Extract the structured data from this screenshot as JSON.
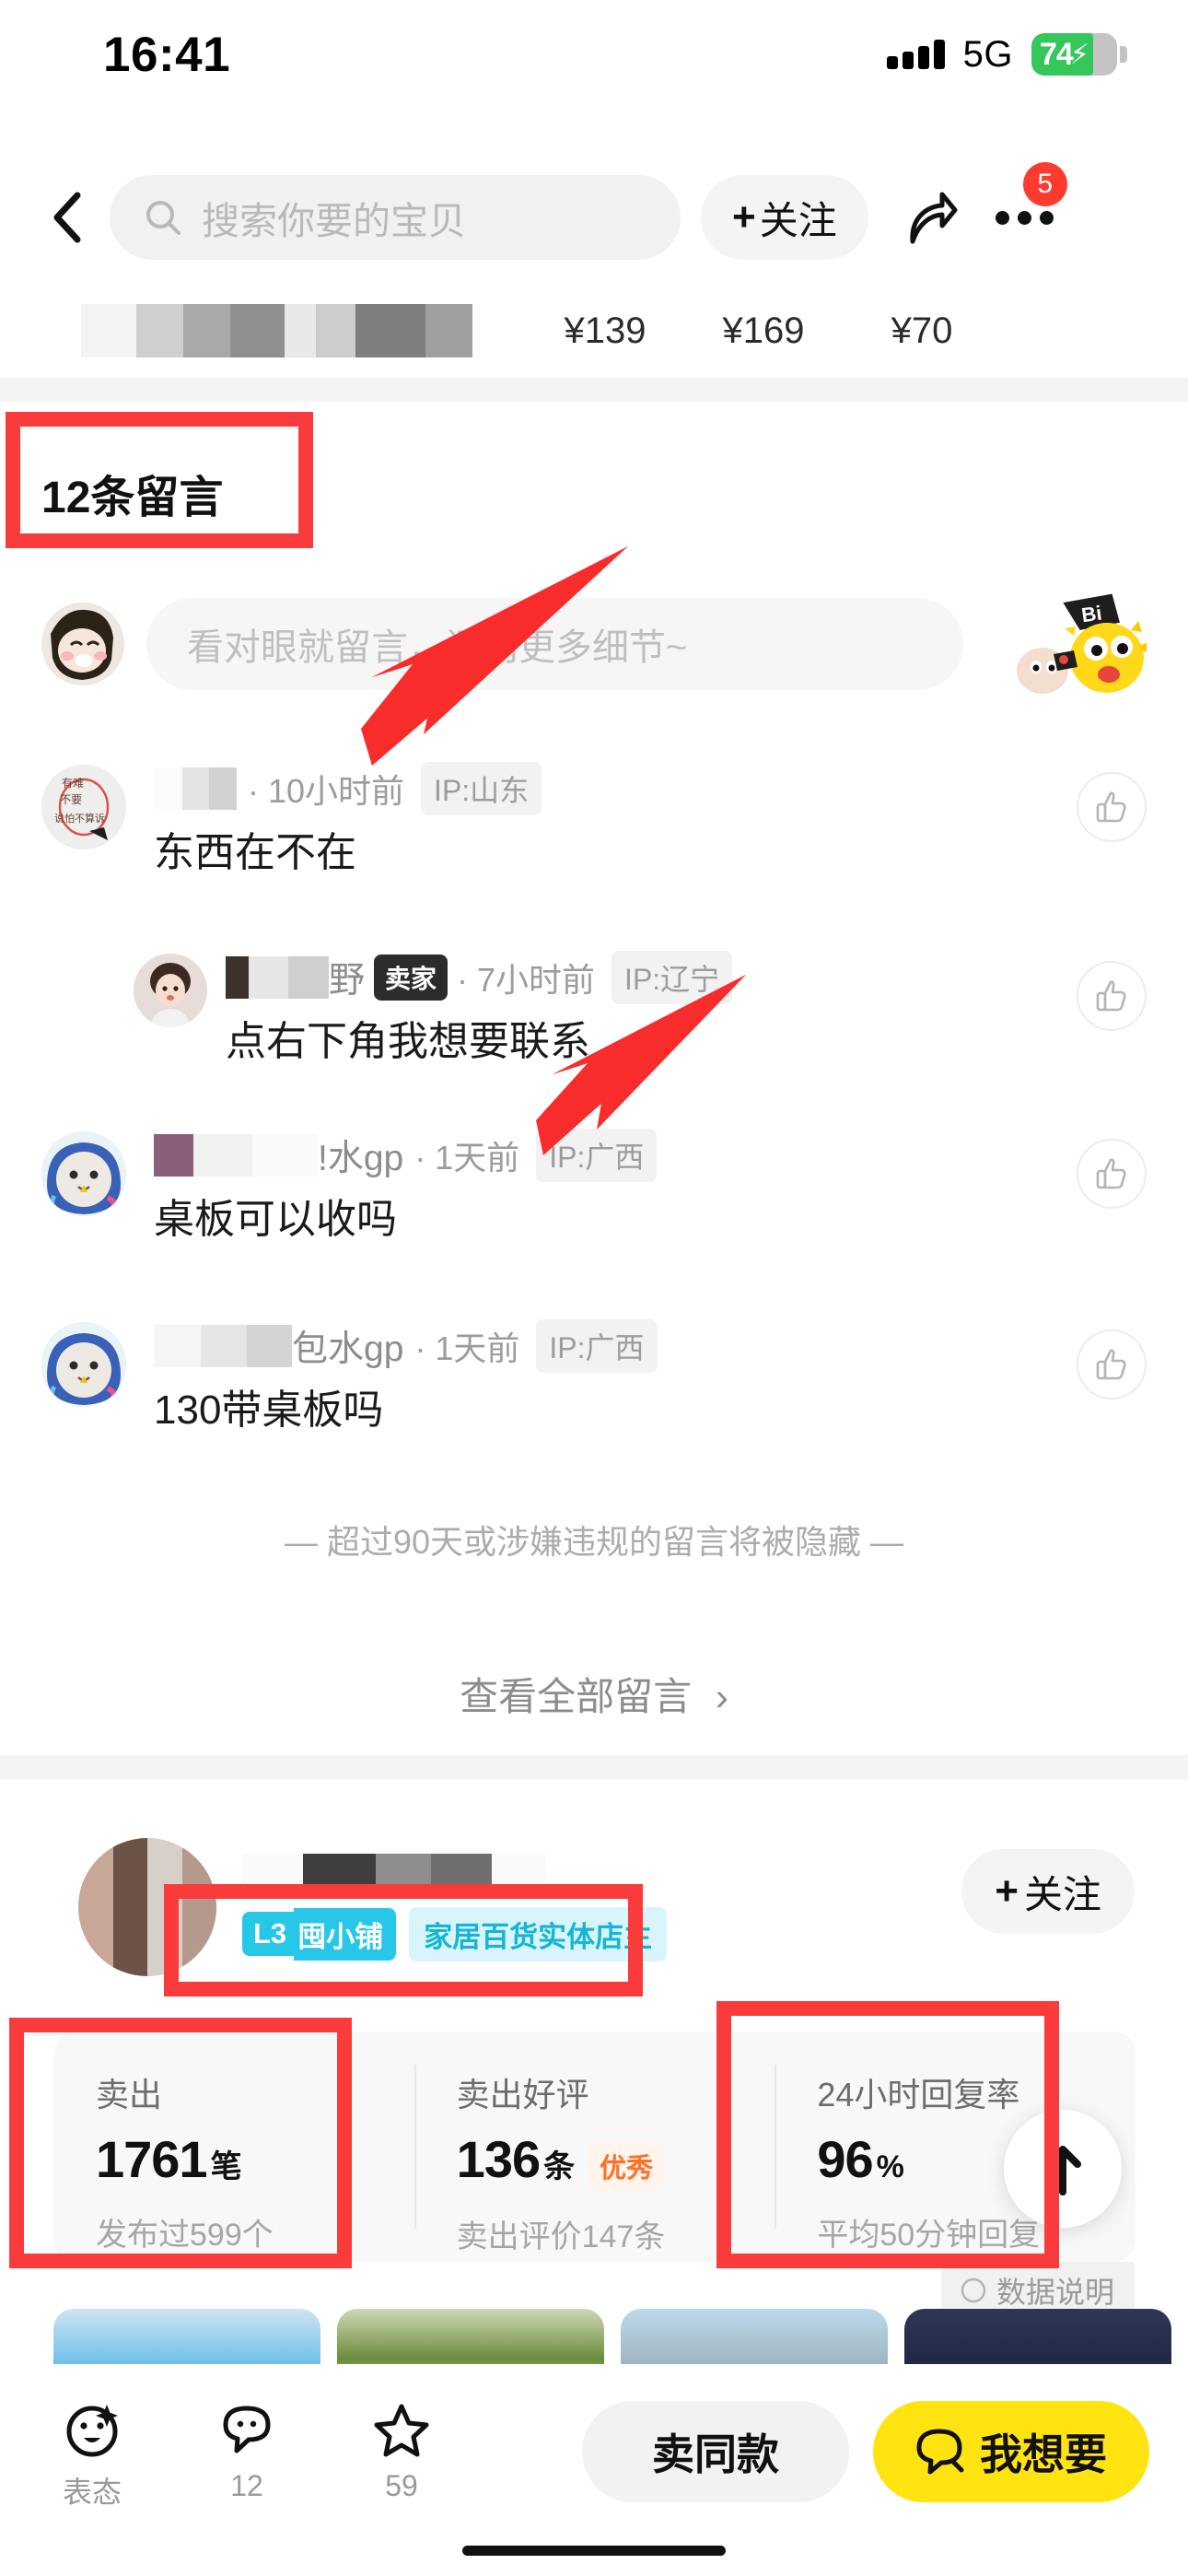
{
  "status_bar": {
    "time": "16:41",
    "network": "5G",
    "battery_percent": "74",
    "charging": true
  },
  "nav": {
    "back_icon": "chevron-left-icon",
    "search_placeholder": "搜索你要的宝贝",
    "follow_label": "关注",
    "share_icon": "share-arrow-icon",
    "more_icon": "more-dots-icon",
    "more_badge": "5"
  },
  "price_row": {
    "prices": [
      "¥139",
      "¥169",
      "¥70"
    ]
  },
  "comments_section": {
    "title": "12条留言",
    "input_placeholder": "看对眼就留言，问问更多细节~",
    "sticker_text": "Bi",
    "hide_note": "— 超过90天或涉嫌违规的留言将被隐藏 —",
    "view_all": "查看全部留言",
    "view_all_chevron": "›",
    "items": [
      {
        "username": "",
        "username_blurred": true,
        "badge": "",
        "time": "· 10小时前",
        "ip": "IP:山东",
        "text": "东西在不在",
        "reply": false
      },
      {
        "username": "野",
        "username_blurred": true,
        "badge": "卖家",
        "time": "· 7小时前",
        "ip": "IP:辽宁",
        "text": "点右下角我想要联系",
        "reply": true
      },
      {
        "username": "!水gp",
        "username_blurred": true,
        "badge": "",
        "time": "· 1天前",
        "ip": "IP:广西",
        "text": "桌板可以收吗",
        "reply": false
      },
      {
        "username": "包水gp",
        "username_blurred": true,
        "badge": "",
        "time": "· 1天前",
        "ip": "IP:广西",
        "text": "130带桌板吗",
        "reply": false
      }
    ]
  },
  "seller": {
    "level_badge": "L3",
    "shop_name": "囤小铺",
    "shop_tag": "家居百货实体店主",
    "follow_label": "关注",
    "data_note": "数据说明",
    "scroll_top_icon": "arrow-up-icon",
    "stats": [
      {
        "label": "卖出",
        "number": "1761",
        "unit": "笔",
        "pill": "",
        "sub": "发布过599个"
      },
      {
        "label": "卖出好评",
        "number": "136",
        "unit": "条",
        "pill": "优秀",
        "sub": "卖出评价147条"
      },
      {
        "label": "24小时回复率",
        "number": "96",
        "unit": "%",
        "pill": "",
        "sub": "平均50分钟回复"
      }
    ]
  },
  "bottom_bar": {
    "actions": [
      {
        "icon": "reaction-face-icon",
        "caption": "表态"
      },
      {
        "icon": "comment-bubble-icon",
        "caption": "12"
      },
      {
        "icon": "star-icon",
        "caption": "59"
      }
    ],
    "sell_same_label": "卖同款",
    "want_label": "我想要",
    "want_icon": "chat-bubble-icon"
  },
  "colors": {
    "annotation_red": "#fa3b3b",
    "brand_yellow": "#ffe411",
    "badge_red": "#ff3b30",
    "battery_green": "#34c759",
    "level_cyan": "#27c7e8",
    "excellent_orange": "#ff7028"
  }
}
